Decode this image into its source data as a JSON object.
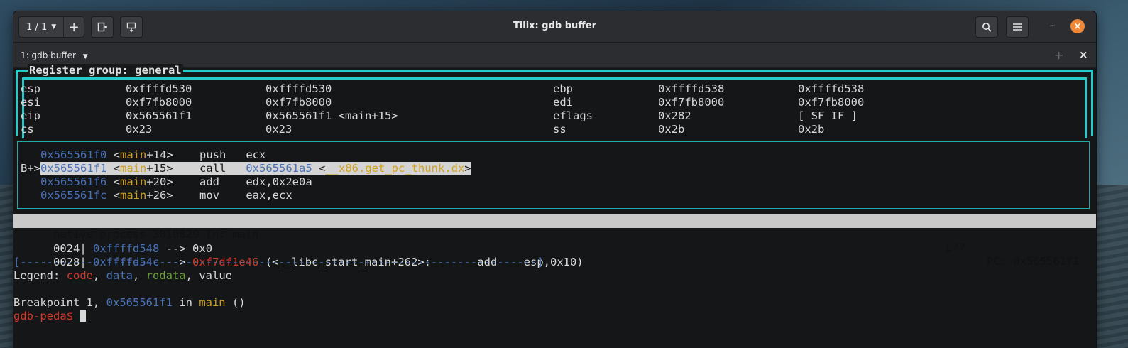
{
  "window": {
    "title": "Tilix: gdb buffer",
    "session_counter": "1 / 1",
    "tab_label": "1: gdb buffer"
  },
  "registers": {
    "group_title": "Register group: general",
    "rows": [
      [
        "esp",
        "0xffffd530",
        "0xffffd530",
        "ebp",
        "0xffffd538",
        "0xffffd538"
      ],
      [
        "esi",
        "0xf7fb8000",
        "0xf7fb8000",
        "edi",
        "0xf7fb8000",
        "0xf7fb8000"
      ],
      [
        "eip",
        "0x565561f1",
        "0x565561f1 <main+15>",
        "eflags",
        "0x282",
        "[ SF IF ]"
      ],
      [
        "cs",
        "0x23",
        "0x23",
        "ss",
        "0x2b",
        "0x2b"
      ]
    ]
  },
  "asm": [
    {
      "prefix": "   ",
      "addr": "0x565561f0",
      "func": "main",
      "off": "+14",
      "op": "push",
      "args": "ecx"
    },
    {
      "prefix": "B+>",
      "addr": "0x565561f1",
      "func": "main",
      "off": "+15",
      "op": "call",
      "target": "0x565561a5",
      "sym": "__x86.get_pc_thunk.dx"
    },
    {
      "prefix": "   ",
      "addr": "0x565561f6",
      "func": "main",
      "off": "+20",
      "op": "add",
      "args": "edx,0x2e0a"
    },
    {
      "prefix": "   ",
      "addr": "0x565561fc",
      "func": "main",
      "off": "+26",
      "op": "mov",
      "args": "eax,ecx"
    }
  ],
  "status": {
    "left": "native process 3019829 In: main",
    "line": "L??",
    "pc": "PC: 0x565561f1"
  },
  "stack": [
    {
      "idx": "0024|",
      "addr": "0xffffd548",
      "arrow": "-->",
      "val": "0x0"
    },
    {
      "idx": "0028|",
      "addr": "0xffffd54c",
      "arrow": "-->",
      "val": "0xf7df1e46",
      "sym": "(<__libc_start_main+262>:",
      "op": "add",
      "args": "esp,0x10)"
    }
  ],
  "separator": "[------------------------------------------------------------------------------]",
  "legend": {
    "prefix": "Legend: ",
    "code": "code",
    "data": "data",
    "rodata": "rodata",
    "value": "value"
  },
  "breakpoint": {
    "text1": "Breakpoint 1, ",
    "addr": "0x565561f1",
    "text2": " in ",
    "func": "main",
    "text3": " ()"
  },
  "prompt": "gdb-peda$ ",
  "colors": {
    "accent_cyan": "#27c9c9",
    "addr_blue": "#4a72b8",
    "sym_yellow": "#d0a020",
    "prompt_red": "#d23a2a",
    "rodata_green": "#6aa034",
    "close_orange": "#f0883a"
  }
}
